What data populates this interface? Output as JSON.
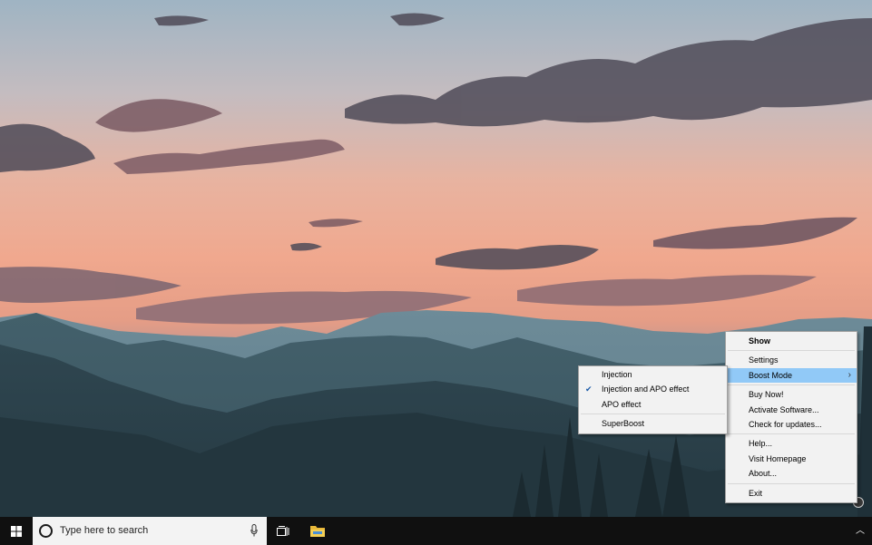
{
  "context_menu": {
    "items": [
      {
        "label": "Show"
      },
      {
        "label": "Settings"
      },
      {
        "label": "Boost Mode"
      },
      {
        "label": "Buy Now!"
      },
      {
        "label": "Activate Software..."
      },
      {
        "label": "Check for updates..."
      },
      {
        "label": "Help..."
      },
      {
        "label": "Visit Homepage"
      },
      {
        "label": "About..."
      },
      {
        "label": "Exit"
      }
    ],
    "highlighted": "Boost Mode"
  },
  "boost_mode_submenu": {
    "items": [
      {
        "label": "Injection",
        "checked": false
      },
      {
        "label": "Injection and APO effect",
        "checked": true
      },
      {
        "label": "APO effect",
        "checked": false
      },
      {
        "label": "SuperBoost",
        "checked": false
      }
    ]
  },
  "taskbar": {
    "search_placeholder": "Type here to search"
  },
  "icons": {
    "start": "windows-logo-icon",
    "cortana": "cortana-circle-icon",
    "mic": "microphone-icon",
    "task_view": "task-view-icon",
    "explorer": "folder-icon",
    "tray_chevron": "chevron-up-icon",
    "check": "checkmark-icon",
    "submenu_arrow": "chevron-right-icon"
  },
  "colors": {
    "menu_background": "#f2f2f2",
    "menu_highlight": "#91c9f7",
    "taskbar": "#101010",
    "search_box": "#f3f3f3"
  }
}
